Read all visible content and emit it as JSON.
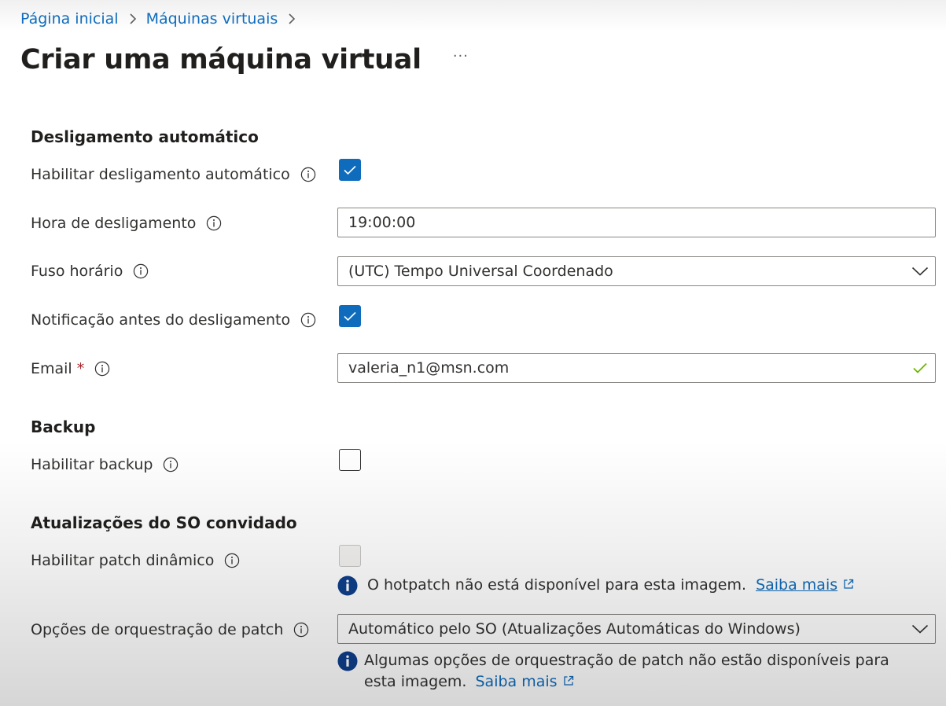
{
  "breadcrumb": {
    "items": [
      "Página inicial",
      "Máquinas virtuais"
    ]
  },
  "header": {
    "title": "Criar uma máquina virtual",
    "more_label": "···"
  },
  "sections": {
    "auto_shutdown": "Desligamento automático",
    "backup": "Backup",
    "guest_os_updates": "Atualizações do SO convidado"
  },
  "form": {
    "enable_auto_shutdown": {
      "label": "Habilitar desligamento automático",
      "checked": true
    },
    "shutdown_time": {
      "label": "Hora de desligamento",
      "value": "19:00:00"
    },
    "time_zone": {
      "label": "Fuso horário",
      "value": "(UTC) Tempo Universal Coordenado"
    },
    "notify_before_shutdown": {
      "label": "Notificação antes do desligamento",
      "checked": true
    },
    "email": {
      "label": "Email",
      "required_mark": "*",
      "value": "valeria_n1@msn.com",
      "valid": true
    },
    "enable_backup": {
      "label": "Habilitar backup",
      "checked": false
    },
    "hotpatch": {
      "label": "Habilitar patch dinâmico",
      "checked": false,
      "disabled": true,
      "info_text": "O hotpatch não está disponível para esta imagem.",
      "link_text": "Saiba mais"
    },
    "patch_orchestration": {
      "label": "Opções de orquestração de patch",
      "value": "Automático pelo SO (Atualizações Automáticas do Windows)",
      "info_text": "Algumas opções de orquestração de patch não estão disponíveis para esta imagem.",
      "link_text": "Saiba mais"
    }
  },
  "icons": {
    "info": "info-icon",
    "chevron": "chevron-down-icon",
    "check": "checkmark-icon",
    "external": "external-link-icon",
    "info_filled": "info-filled-icon"
  },
  "colors": {
    "accent": "#0f6cbd",
    "required": "#a4262c",
    "valid": "#6bb700",
    "text": "#323130",
    "info_dot": "#0f3f8c"
  }
}
